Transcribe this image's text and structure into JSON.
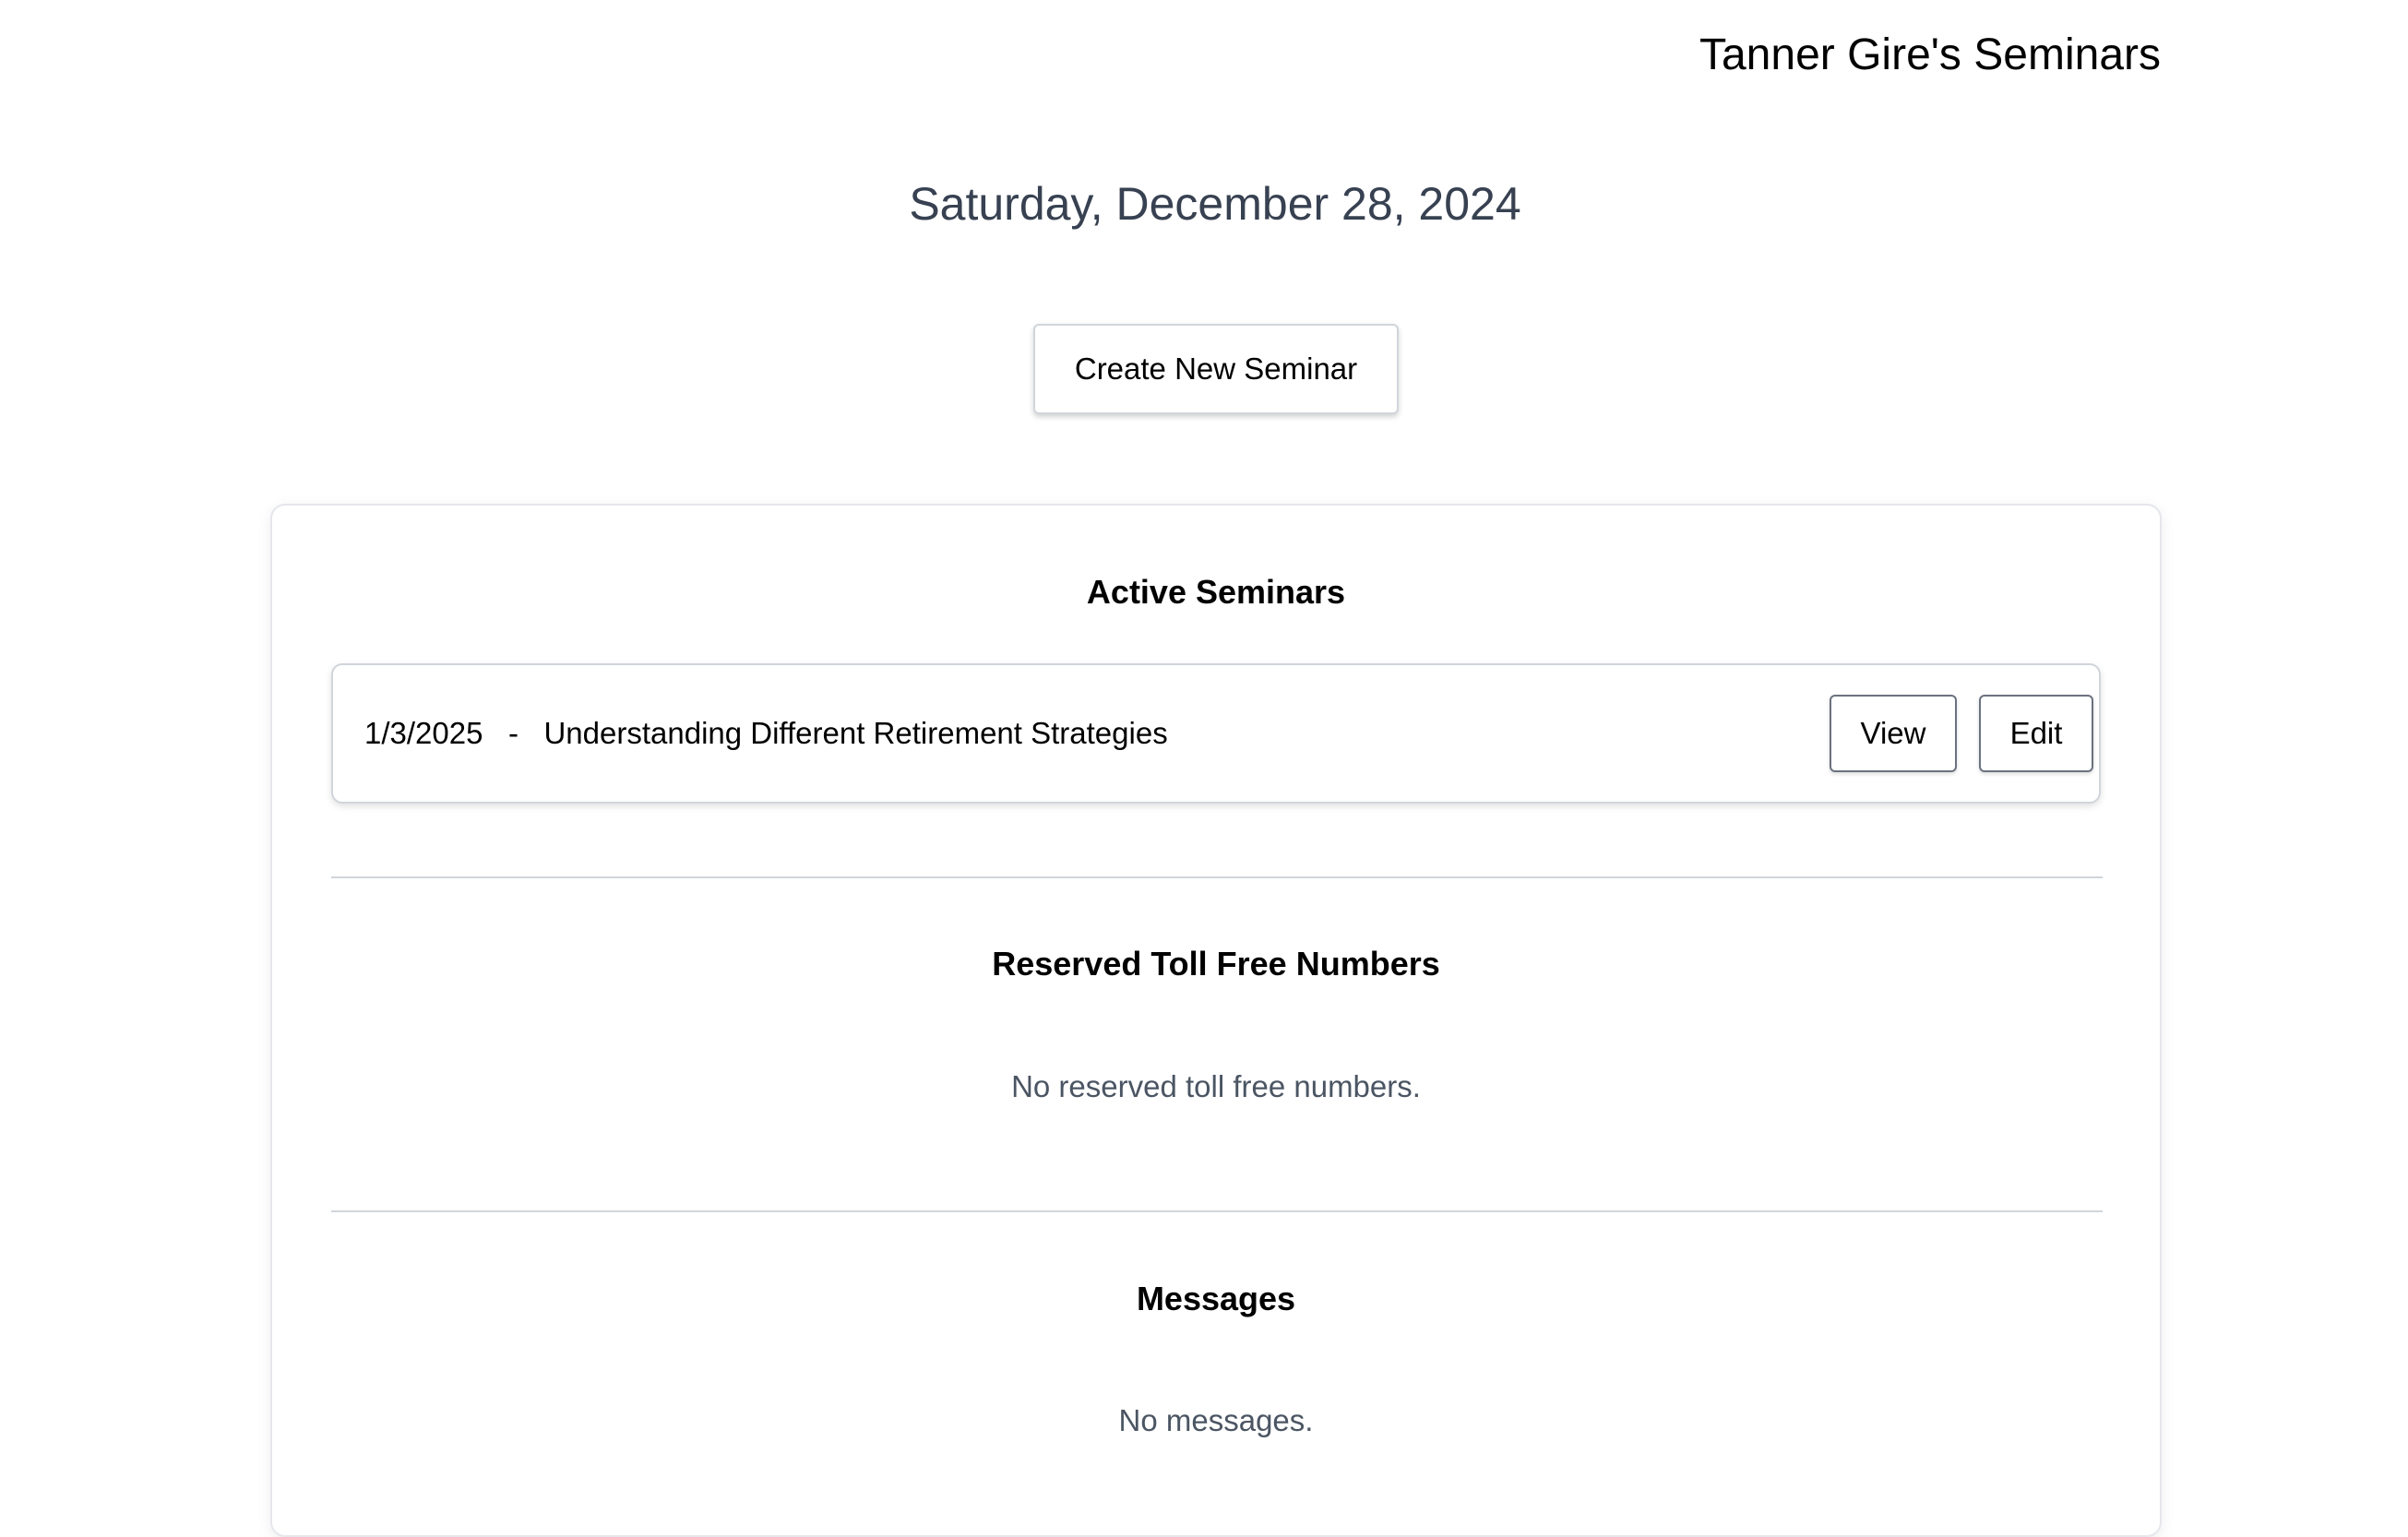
{
  "header": {
    "title": "Tanner Gire's Seminars"
  },
  "date": "Saturday, December 28, 2024",
  "actions": {
    "create_label": "Create New Seminar"
  },
  "active_seminars": {
    "title": "Active Seminars",
    "items": [
      {
        "text": "1/3/2025   -   Understanding Different Retirement Strategies",
        "view_label": "View",
        "edit_label": "Edit"
      }
    ]
  },
  "toll_free": {
    "title": "Reserved Toll Free Numbers",
    "empty_text": "No reserved toll free numbers."
  },
  "messages": {
    "title": "Messages",
    "empty_text": "No messages."
  },
  "colors": {
    "date_text": "#374151",
    "muted_text": "#4b5563",
    "border": "#d1d5db"
  }
}
